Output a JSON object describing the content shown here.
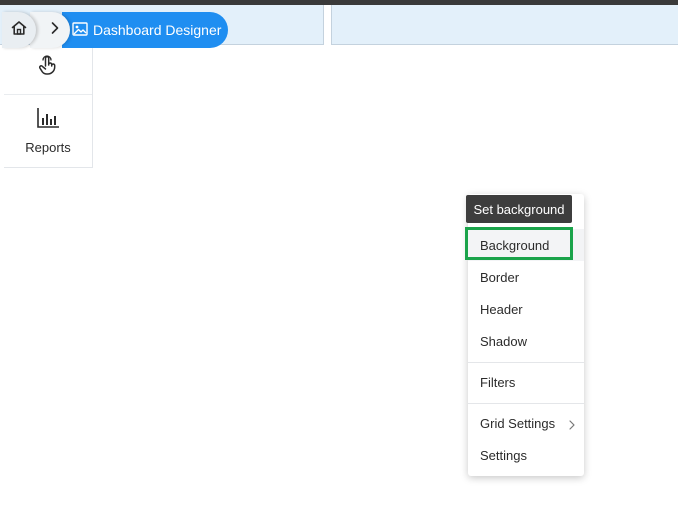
{
  "breadcrumb": {
    "home_icon": "home-icon",
    "separator_icon": "chevron-right-icon",
    "current_icon": "image-icon",
    "current_label": "Dashboard Designer"
  },
  "sidebar": {
    "items": [
      {
        "icon": "touch-pointer-icon",
        "label": ""
      },
      {
        "icon": "bar-chart-icon",
        "label": "Reports"
      }
    ]
  },
  "context_menu": {
    "tooltip": "Set background",
    "items": [
      {
        "label": "Background"
      },
      {
        "label": "Border"
      },
      {
        "label": "Header"
      },
      {
        "label": "Shadow"
      },
      {
        "label": "Filters"
      },
      {
        "label": "Grid Settings",
        "has_submenu": true
      },
      {
        "label": "Settings"
      }
    ]
  },
  "colors": {
    "accent": "#1f8ef1",
    "header_bg": "#e3f0fa",
    "highlight": "#1aa34a",
    "tooltip_bg": "#3d3d3d"
  }
}
